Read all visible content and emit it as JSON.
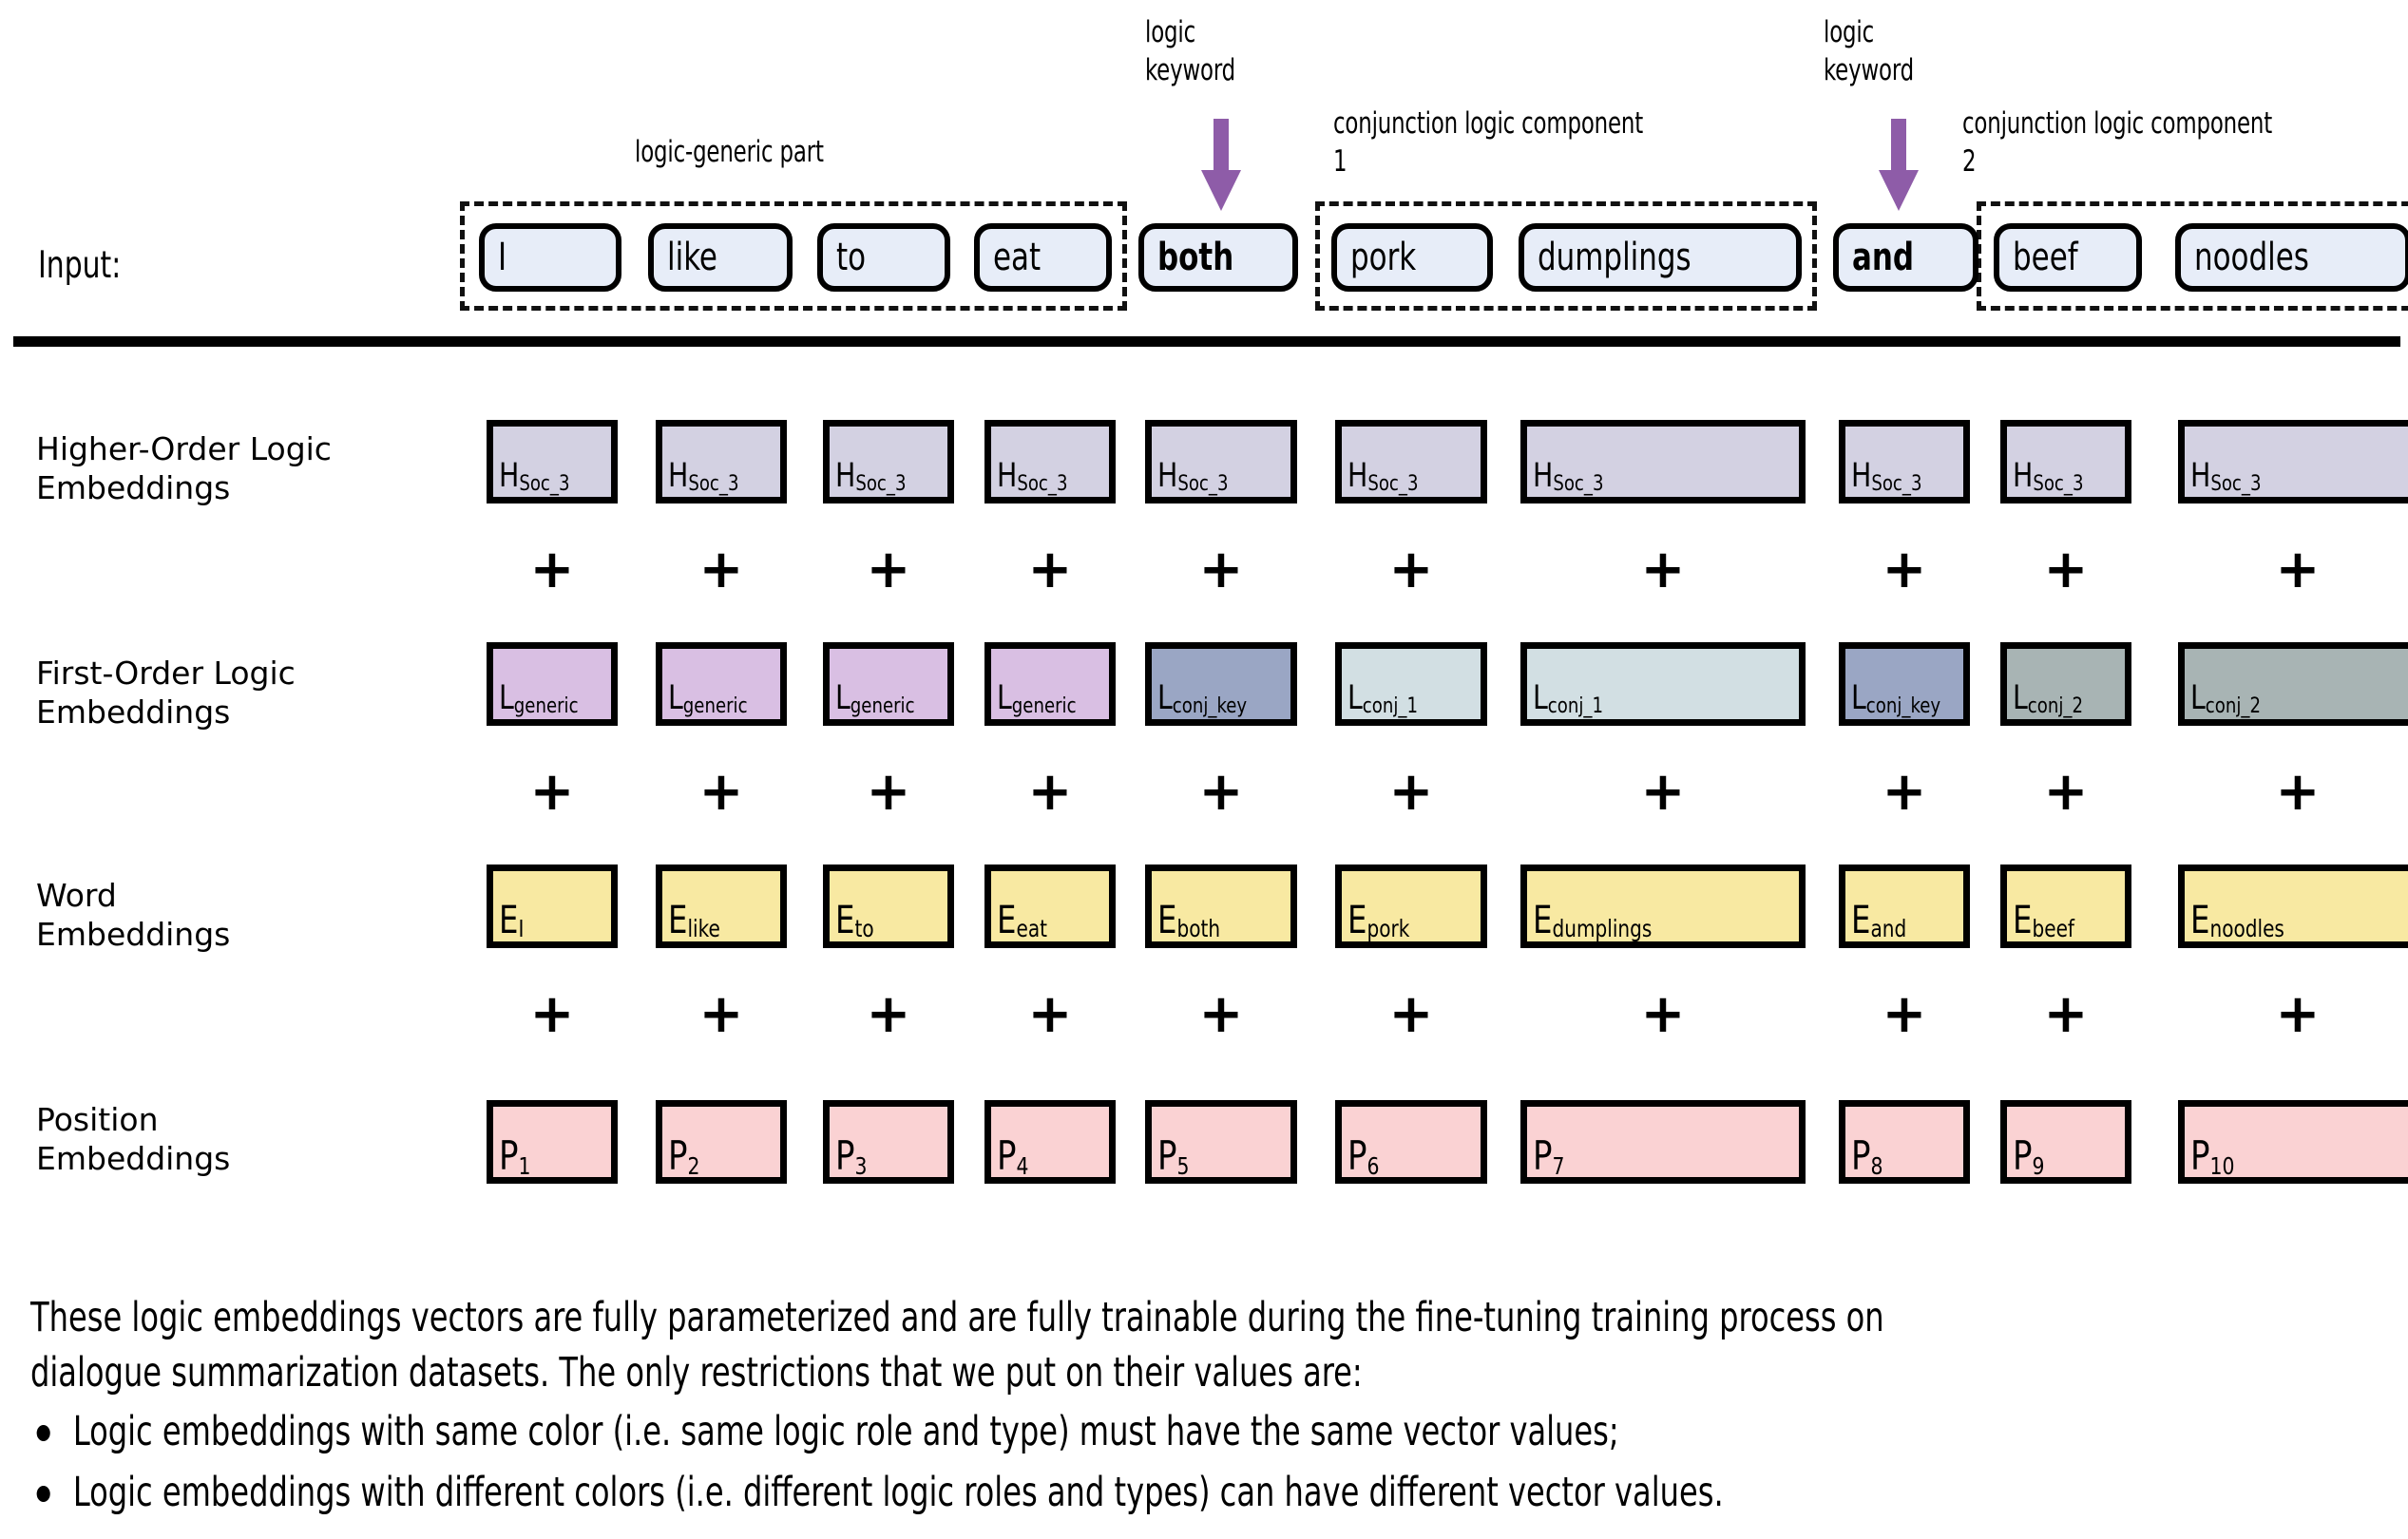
{
  "colors": {
    "token_fill": "#e7edf8",
    "higher_order": "#d3d1e2",
    "logic_generic": "#d9bfe3",
    "logic_conj_key": "#9aa6c4",
    "logic_conj_1": "#d2dfe3",
    "logic_conj_2": "#a8b4b4",
    "word": "#f8e9a2",
    "position": "#fad2d3",
    "arrow": "#8e5ca8",
    "outline": "#000000"
  },
  "annotations": {
    "logic_generic_part": "logic-generic part",
    "logic_keyword_1": "logic\nkeyword",
    "logic_keyword_2": "logic\nkeyword",
    "conjunction_component_1": "conjunction logic component\n1",
    "conjunction_component_2": "conjunction logic component\n2"
  },
  "input": {
    "label": "Input:",
    "tokens": [
      {
        "text": "I",
        "bold": false
      },
      {
        "text": "like",
        "bold": false
      },
      {
        "text": "to",
        "bold": false
      },
      {
        "text": "eat",
        "bold": false
      },
      {
        "text": "both",
        "bold": true
      },
      {
        "text": "pork",
        "bold": false
      },
      {
        "text": "dumplings",
        "bold": false
      },
      {
        "text": "and",
        "bold": true
      },
      {
        "text": "beef",
        "bold": false
      },
      {
        "text": "noodles",
        "bold": false
      }
    ]
  },
  "rows": [
    {
      "label": "Higher-Order Logic\nEmbeddings",
      "name": "higher-order-logic-embeddings",
      "cells": [
        {
          "base": "H",
          "sub": "Soc_3",
          "color": "#d3d1e2"
        },
        {
          "base": "H",
          "sub": "Soc_3",
          "color": "#d3d1e2"
        },
        {
          "base": "H",
          "sub": "Soc_3",
          "color": "#d3d1e2"
        },
        {
          "base": "H",
          "sub": "Soc_3",
          "color": "#d3d1e2"
        },
        {
          "base": "H",
          "sub": "Soc_3",
          "color": "#d3d1e2"
        },
        {
          "base": "H",
          "sub": "Soc_3",
          "color": "#d3d1e2"
        },
        {
          "base": "H",
          "sub": "Soc_3",
          "color": "#d3d1e2"
        },
        {
          "base": "H",
          "sub": "Soc_3",
          "color": "#d3d1e2"
        },
        {
          "base": "H",
          "sub": "Soc_3",
          "color": "#d3d1e2"
        },
        {
          "base": "H",
          "sub": "Soc_3",
          "color": "#d3d1e2"
        }
      ]
    },
    {
      "label": "First-Order Logic\nEmbeddings",
      "name": "first-order-logic-embeddings",
      "cells": [
        {
          "base": "L",
          "sub": "generic",
          "color": "#d9bfe3"
        },
        {
          "base": "L",
          "sub": "generic",
          "color": "#d9bfe3"
        },
        {
          "base": "L",
          "sub": "generic",
          "color": "#d9bfe3"
        },
        {
          "base": "L",
          "sub": "generic",
          "color": "#d9bfe3"
        },
        {
          "base": "L",
          "sub": "conj_key",
          "color": "#9aa6c4"
        },
        {
          "base": "L",
          "sub": "conj_1",
          "color": "#d2dfe3"
        },
        {
          "base": "L",
          "sub": "conj_1",
          "color": "#d2dfe3"
        },
        {
          "base": "L",
          "sub": "conj_key",
          "color": "#9aa6c4"
        },
        {
          "base": "L",
          "sub": "conj_2",
          "color": "#a8b4b4"
        },
        {
          "base": "L",
          "sub": "conj_2",
          "color": "#a8b4b4"
        }
      ]
    },
    {
      "label": "Word\nEmbeddings",
      "name": "word-embeddings",
      "cells": [
        {
          "base": "E",
          "sub": "I",
          "color": "#f8e9a2"
        },
        {
          "base": "E",
          "sub": "like",
          "color": "#f8e9a2"
        },
        {
          "base": "E",
          "sub": "to",
          "color": "#f8e9a2"
        },
        {
          "base": "E",
          "sub": "eat",
          "color": "#f8e9a2"
        },
        {
          "base": "E",
          "sub": "both",
          "color": "#f8e9a2"
        },
        {
          "base": "E",
          "sub": "pork",
          "color": "#f8e9a2"
        },
        {
          "base": "E",
          "sub": "dumplings",
          "color": "#f8e9a2"
        },
        {
          "base": "E",
          "sub": "and",
          "color": "#f8e9a2"
        },
        {
          "base": "E",
          "sub": "beef",
          "color": "#f8e9a2"
        },
        {
          "base": "E",
          "sub": "noodles",
          "color": "#f8e9a2"
        }
      ]
    },
    {
      "label": "Position\nEmbeddings",
      "name": "position-embeddings",
      "cells": [
        {
          "base": "P",
          "sub": "1",
          "color": "#fad2d3"
        },
        {
          "base": "P",
          "sub": "2",
          "color": "#fad2d3"
        },
        {
          "base": "P",
          "sub": "3",
          "color": "#fad2d3"
        },
        {
          "base": "P",
          "sub": "4",
          "color": "#fad2d3"
        },
        {
          "base": "P",
          "sub": "5",
          "color": "#fad2d3"
        },
        {
          "base": "P",
          "sub": "6",
          "color": "#fad2d3"
        },
        {
          "base": "P",
          "sub": "7",
          "color": "#fad2d3"
        },
        {
          "base": "P",
          "sub": "8",
          "color": "#fad2d3"
        },
        {
          "base": "P",
          "sub": "9",
          "color": "#fad2d3"
        },
        {
          "base": "P",
          "sub": "10",
          "color": "#fad2d3"
        }
      ]
    }
  ],
  "plus_symbol": "+",
  "note": {
    "paragraph": "These logic embeddings vectors are fully parameterized and are fully trainable during the fine-tuning training process on\ndialogue summarization datasets. The only restrictions that we put on their values are:",
    "bullets": [
      "Logic embeddings with same color (i.e. same logic role and type) must have the same vector values;",
      "Logic embeddings with different colors (i.e. different logic roles and types) can have different vector values."
    ]
  }
}
